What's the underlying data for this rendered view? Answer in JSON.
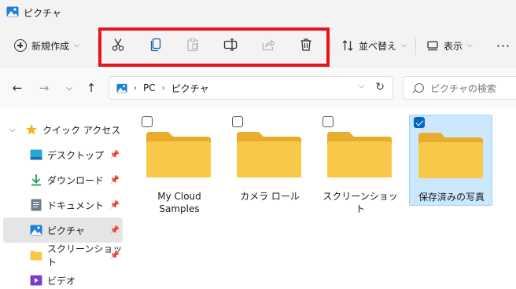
{
  "window": {
    "title": "ピクチャ"
  },
  "toolbar": {
    "new_label": "新規作成",
    "sort_label": "並べ替え",
    "view_label": "表示",
    "more_label": "···",
    "highlight_color": "#e5161a"
  },
  "address": {
    "segments": [
      "PC",
      "ピクチャ"
    ],
    "search_placeholder": "ピクチャの検索"
  },
  "sidebar": {
    "items": [
      {
        "label": "クイック アクセス",
        "icon": "star-icon"
      },
      {
        "label": "デスクトップ",
        "icon": "desktop-icon",
        "pinned": true
      },
      {
        "label": "ダウンロード",
        "icon": "download-icon",
        "pinned": true
      },
      {
        "label": "ドキュメント",
        "icon": "document-icon",
        "pinned": true
      },
      {
        "label": "ピクチャ",
        "icon": "pictures-icon",
        "pinned": true,
        "selected": true
      },
      {
        "label": "スクリーンショット",
        "icon": "folder-icon",
        "pinned": true
      },
      {
        "label": "ビデオ",
        "icon": "video-icon"
      }
    ]
  },
  "folders": [
    {
      "label": "My Cloud Samples",
      "checked": false,
      "selected": false
    },
    {
      "label": "カメラ ロール",
      "checked": false,
      "selected": false
    },
    {
      "label": "スクリーンショット",
      "checked": false,
      "selected": false
    },
    {
      "label": "保存済みの写真",
      "checked": true,
      "selected": true
    }
  ],
  "colors": {
    "accent": "#0067c0",
    "folder": "#f8c848",
    "selection": "#cce8ff"
  }
}
